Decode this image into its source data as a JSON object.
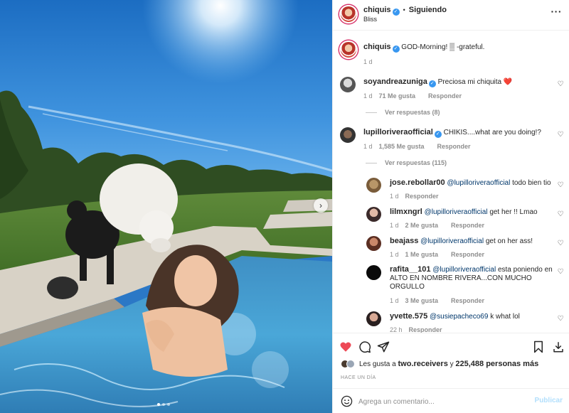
{
  "header": {
    "username": "chiquis",
    "separator": "•",
    "follow_status": "Siguiendo",
    "location": "Bliss",
    "more_icon": "more-horizontal-icon"
  },
  "caption": {
    "username": "chiquis",
    "text": "GOD-Morning! ▒ -grateful.",
    "time": "1 d"
  },
  "comments": [
    {
      "username": "soyandreazuniga",
      "verified": true,
      "text": "Preciosa mi chiquita ❤️",
      "time": "1 d",
      "likes": "71 Me gusta",
      "reply": "Responder",
      "view_replies": "Ver respuestas (8)"
    },
    {
      "username": "lupilloriveraofficial",
      "verified": true,
      "text": "CHIKIS....what are you doing!?",
      "time": "1 d",
      "likes": "1,585 Me gusta",
      "reply": "Responder",
      "view_replies": "Ver respuestas (115)"
    }
  ],
  "replies": [
    {
      "username": "jose.rebollar00",
      "mention": "@lupilloriveraofficial",
      "text": "todo bien tio",
      "time": "1 d",
      "likes": "",
      "reply": "Responder"
    },
    {
      "username": "lilmxngrl",
      "mention": "@lupilloriveraofficial",
      "text": "get her !! Lmao",
      "time": "1 d",
      "likes": "2 Me gusta",
      "reply": "Responder"
    },
    {
      "username": "beajass",
      "mention": "@lupilloriveraofficial",
      "text": "get on her ass!",
      "time": "1 d",
      "likes": "1 Me gusta",
      "reply": "Responder"
    },
    {
      "username": "rafita__101",
      "mention": "@lupilloriveraofficial",
      "text_line1": "esta poniendo en",
      "text_line2": "ALTO EN NOMBRE RIVERA...CON MUCHO",
      "text_line3": "ORGULLO",
      "time": "1 d",
      "likes": "3 Me gusta",
      "reply": "Responder"
    },
    {
      "username": "yvette.575",
      "mention": "@susiepacheco69",
      "text": "k what lol",
      "time": "22 h",
      "likes": "",
      "reply": "Responder"
    }
  ],
  "actions": {
    "like_icon": "heart-filled-icon",
    "comment_icon": "comment-icon",
    "share_icon": "share-icon",
    "save_icon": "bookmark-icon",
    "likes_prefix": "Les gusta a",
    "likes_user": "two.receivers",
    "likes_and": "y",
    "likes_count": "225,488 personas más",
    "posted": "HACE UN DÍA"
  },
  "comment_input": {
    "placeholder": "Agrega un comentario...",
    "publish": "Publicar",
    "emoji_icon": "emoji-icon"
  },
  "carousel": {
    "slides": 3,
    "active": 1,
    "next_icon": "chevron-right-icon"
  },
  "colors": {
    "like_red": "#ed4956",
    "verified_blue": "#3897f0",
    "link_blue": "#00376b",
    "publish_disabled": "#b2dffc"
  }
}
